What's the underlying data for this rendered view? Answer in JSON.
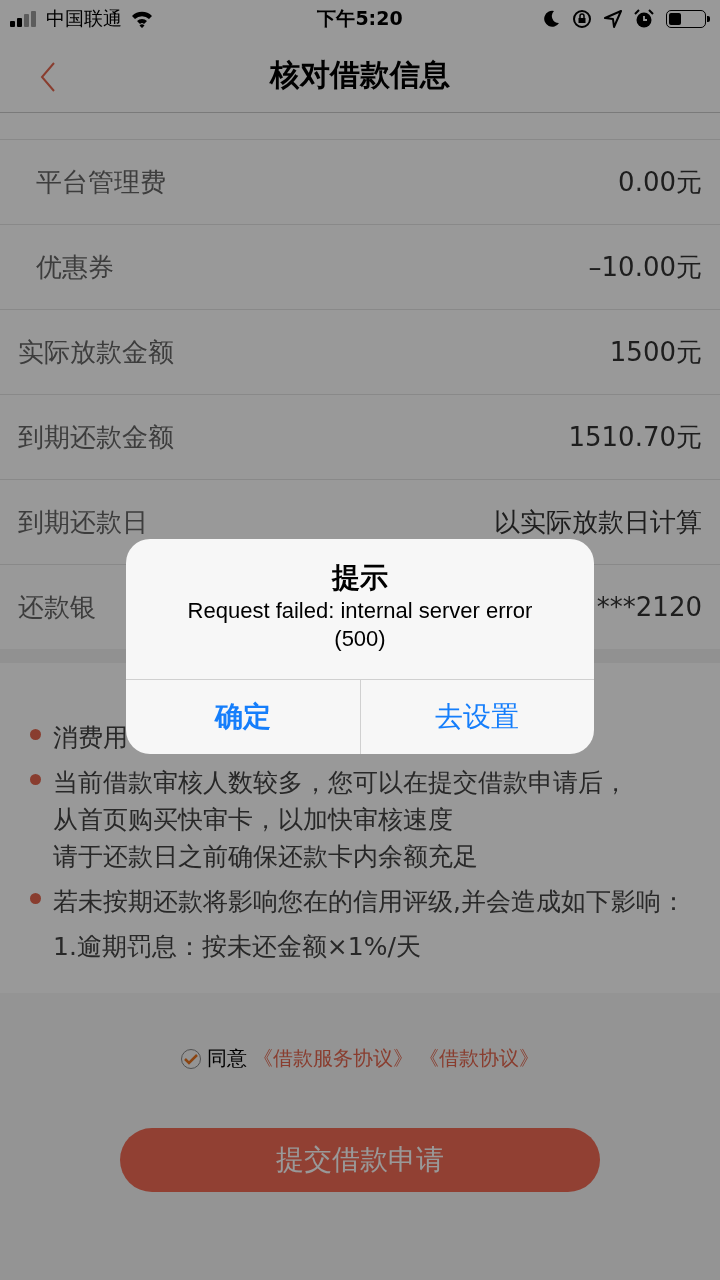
{
  "status_bar": {
    "carrier": "中国联通",
    "time": "下午5:20",
    "battery": {
      "level": 0.35
    }
  },
  "nav": {
    "title": "核对借款信息"
  },
  "rows": [
    {
      "label": "平台管理费",
      "value": "0.00元",
      "indented": true
    },
    {
      "label": "优惠券",
      "value": "–10.00元",
      "indented": true
    },
    {
      "label": "实际放款金额",
      "value": "1500元",
      "indented": false
    },
    {
      "label": "到期还款金额",
      "value": "1510.70元",
      "indented": false
    },
    {
      "label": "到期还款日",
      "value": "以实际放款日计算",
      "indented": false
    },
    {
      "label": "还款银",
      "value": "***2120",
      "indented": false
    }
  ],
  "notes": [
    {
      "kind": "bullet",
      "lines": [
        "消费用"
      ]
    },
    {
      "kind": "bullet",
      "lines": [
        "当前借款审核人数较多，您可以在提交借款申请后，",
        "从首页购买快审卡，以加快审核速度",
        "请于还款日之前确保还款卡内余额充足"
      ]
    },
    {
      "kind": "bullet",
      "lines": [
        "若未按期还款将影响您在的信用评级,并会造成如下影响："
      ]
    },
    {
      "kind": "plain",
      "lines": [
        "1.逾期罚息：按未还金额×1%/天"
      ]
    }
  ],
  "agreement": {
    "checked": true,
    "label": "同意",
    "links": [
      "《借款服务协议》",
      "《借款协议》"
    ]
  },
  "submit": {
    "label": "提交借款申请"
  },
  "alert": {
    "title": "提示",
    "message": "Request failed: internal server error (500)",
    "buttons": [
      {
        "label": "确定",
        "bold": true
      },
      {
        "label": "去设置",
        "bold": false
      }
    ]
  }
}
